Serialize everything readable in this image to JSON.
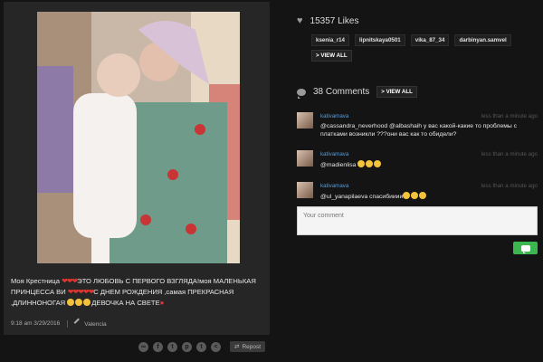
{
  "post": {
    "caption_part1": "Моя Крестница ",
    "caption_part2": "ЭТО ЛЮБОВЬ С ПЕРВОГО ВЗГЛЯДА!моя МАЛЕНЬКАЯ ПРИНЦЕССА ВИ ",
    "caption_part3": "С ДНЕМ РОЖДЕНИЯ ,самая ПРЕКРАСНАЯ ,ДЛИННОНОГАЯ ",
    "caption_part4": "ДЕВОЧКА НА СВЕТЕ",
    "hearts3": "❤❤❤",
    "hearts5": "❤❤❤❤❤",
    "timestamp": "9:18 am 3/29/2016",
    "location": "Valencia"
  },
  "share": {
    "icons": [
      "link-icon",
      "facebook-icon",
      "twitter-icon",
      "pinterest-icon",
      "tumblr-icon",
      "share-icon"
    ],
    "repost_label": "Repost"
  },
  "likes": {
    "count_label": "15357 Likes",
    "users": [
      "ksenia_r14",
      "lipnitskaya0501",
      "vika_87_34",
      "darbinyan.samvel"
    ],
    "view_all": "> VIEW ALL"
  },
  "comments": {
    "count_label": "38 Comments",
    "view_all": "> VIEW ALL",
    "items": [
      {
        "user": "kativamava",
        "time": "less than a minute ago",
        "text": "@cassandra_neverhood @albashaih у вас какой-какие то проблемы с платками возникли ???они вас как то обидели?"
      },
      {
        "user": "kativamava",
        "time": "less than a minute ago",
        "text": "@madienlisa "
      },
      {
        "user": "kativamava",
        "time": "less than a minute ago",
        "text": "@ul_yanapilaeva спасибииии"
      }
    ],
    "input_placeholder": "Your comment"
  },
  "colors": {
    "username": "#5a9bd5",
    "send_button": "#3cb64e",
    "heart": "#e0342f"
  }
}
